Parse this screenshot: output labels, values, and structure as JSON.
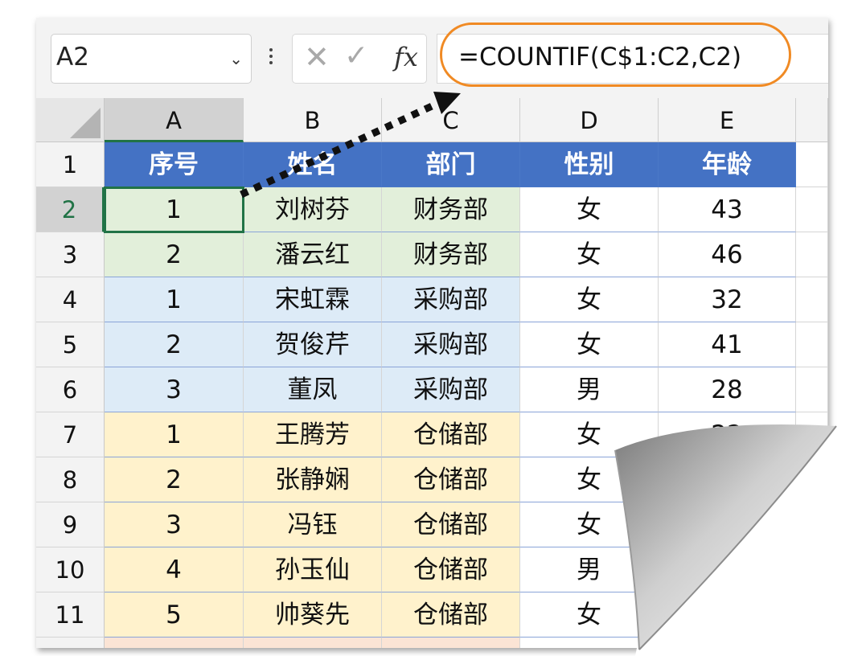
{
  "formula_bar": {
    "name_box": "A2",
    "formula": "=COUNTIF(C$1:C2,C2)",
    "fx_label": "fx",
    "cancel_glyph": "✕",
    "enter_glyph": "✓",
    "dropdown_glyph": "⌄"
  },
  "columns": [
    "A",
    "B",
    "C",
    "D",
    "E"
  ],
  "rows": [
    "1",
    "2",
    "3",
    "4",
    "5",
    "6",
    "7",
    "8",
    "9",
    "10",
    "11"
  ],
  "headers": [
    "序号",
    "姓名",
    "部门",
    "性别",
    "年龄"
  ],
  "data": [
    [
      "1",
      "刘树芬",
      "财务部",
      "女",
      "43"
    ],
    [
      "2",
      "潘云红",
      "财务部",
      "女",
      "46"
    ],
    [
      "1",
      "宋虹霖",
      "采购部",
      "女",
      "32"
    ],
    [
      "2",
      "贺俊芹",
      "采购部",
      "女",
      "41"
    ],
    [
      "3",
      "董凤",
      "采购部",
      "男",
      "28"
    ],
    [
      "1",
      "王腾芳",
      "仓储部",
      "女",
      "22"
    ],
    [
      "2",
      "张静娴",
      "仓储部",
      "女",
      ""
    ],
    [
      "3",
      "冯钰",
      "仓储部",
      "女",
      ""
    ],
    [
      "4",
      "孙玉仙",
      "仓储部",
      "男",
      ""
    ],
    [
      "5",
      "帅葵先",
      "仓储部",
      "女",
      ""
    ]
  ],
  "colors": {
    "header_fill": "#4472c4",
    "finance_fill": "#e2efda",
    "purchase_fill": "#ddebf7",
    "storage_fill": "#fff2cc",
    "next_group_fill": "#fbe4d5",
    "active_border": "#217346",
    "annotation_oval": "#f08a24"
  }
}
